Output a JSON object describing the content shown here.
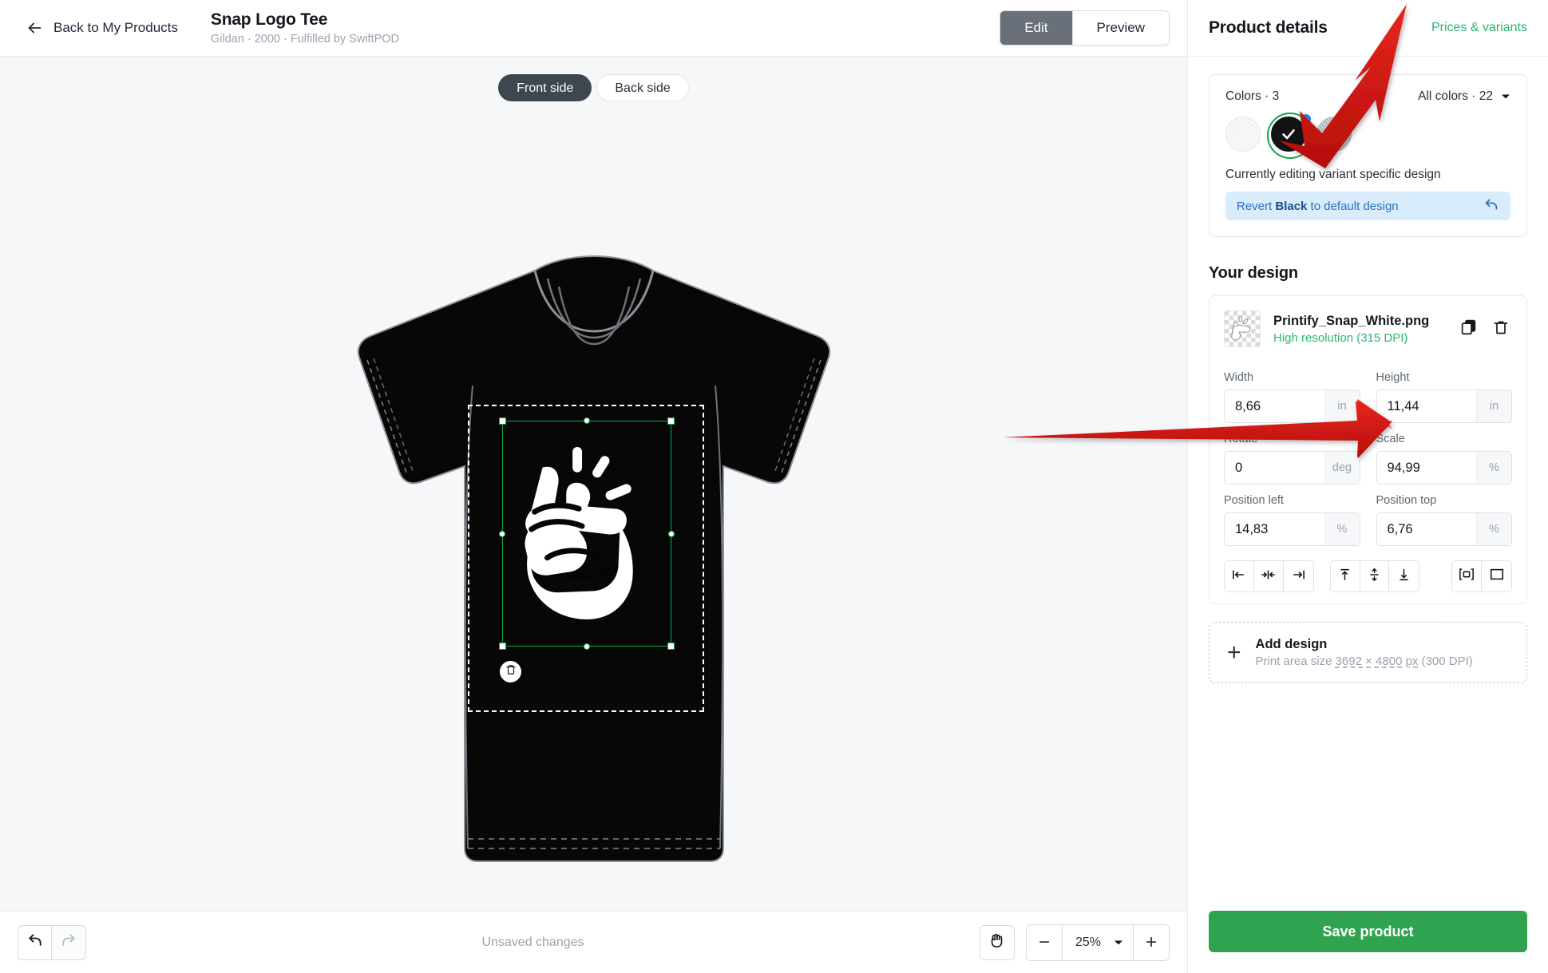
{
  "header": {
    "back_label": "Back to My Products",
    "back_icon": "arrow-left-icon",
    "product_title": "Snap Logo Tee",
    "product_subtitle": "Gildan · 2000 · Fulfilled by SwiftPOD",
    "mode_tabs": [
      {
        "label": "Edit",
        "active": true
      },
      {
        "label": "Preview",
        "active": false
      }
    ]
  },
  "canvas": {
    "side_tabs": [
      {
        "label": "Front side",
        "active": true
      },
      {
        "label": "Back side",
        "active": false
      }
    ],
    "shirt_color": "#050505",
    "selection_color": "#16a34a",
    "print_area_color": "#ffffff",
    "delete_icon": "trash-icon",
    "design_icon": "snapping-fingers-icon"
  },
  "bottombar": {
    "undo_icon": "undo-icon",
    "redo_icon": "redo-icon",
    "status": "Unsaved changes",
    "pan_icon": "hand-icon",
    "zoom_out_label": "−",
    "zoom_level": "25%",
    "zoom_caret_icon": "chevron-down-icon",
    "zoom_in_label": "+"
  },
  "panel": {
    "title": "Product details",
    "link": "Prices & variants",
    "colors": {
      "label": "Colors · 3",
      "all_colors": "All colors · 22",
      "caret_icon": "chevron-down-icon",
      "swatches": [
        {
          "name": "White",
          "hex": "#f7f7f7",
          "selected": false,
          "badge": false
        },
        {
          "name": "Black",
          "hex": "#111315",
          "selected": true,
          "badge": true
        },
        {
          "name": "Sport Grey",
          "hex": "#b9bdc1",
          "selected": false,
          "badge": false
        }
      ],
      "editing_note": "Currently editing variant specific design",
      "revert_prefix": "Revert ",
      "revert_variant": "Black",
      "revert_suffix": " to default design",
      "revert_icon": "undo-icon"
    },
    "design_section_title": "Your design",
    "design": {
      "file_name": "Printify_Snap_White.png",
      "resolution": "High resolution (315 DPI)",
      "duplicate_icon": "copy-icon",
      "delete_icon": "trash-icon",
      "fields": [
        {
          "label": "Width",
          "value": "8,66",
          "unit": "in",
          "name": "width"
        },
        {
          "label": "Height",
          "value": "11,44",
          "unit": "in",
          "name": "height"
        },
        {
          "label": "Rotate",
          "value": "0",
          "unit": "deg",
          "name": "rotate"
        },
        {
          "label": "Scale",
          "value": "94,99",
          "unit": "%",
          "name": "scale"
        },
        {
          "label": "Position left",
          "value": "14,83",
          "unit": "%",
          "name": "position-left"
        },
        {
          "label": "Position top",
          "value": "6,76",
          "unit": "%",
          "name": "position-top"
        }
      ],
      "align_buttons": [
        "align-left-icon",
        "align-center-horizontal-icon",
        "align-right-icon",
        "align-top-icon",
        "align-middle-vertical-icon",
        "align-bottom-icon",
        "fit-to-area-icon",
        "fill-area-icon"
      ]
    },
    "add_design": {
      "plus_icon": "plus-icon",
      "title": "Add design",
      "subtitle_prefix": "Print area size ",
      "subtitle_size": "3692 × 4800 px",
      "subtitle_suffix": " (300 DPI)"
    },
    "save_label": "Save product"
  },
  "annotations": {
    "arrow_color": "#d91b15",
    "arrows": [
      {
        "name": "arrow-to-color-swatch",
        "points_at": "black-color-swatch"
      },
      {
        "name": "arrow-to-design-fields",
        "points_at": "design-dimension-fields"
      }
    ]
  }
}
